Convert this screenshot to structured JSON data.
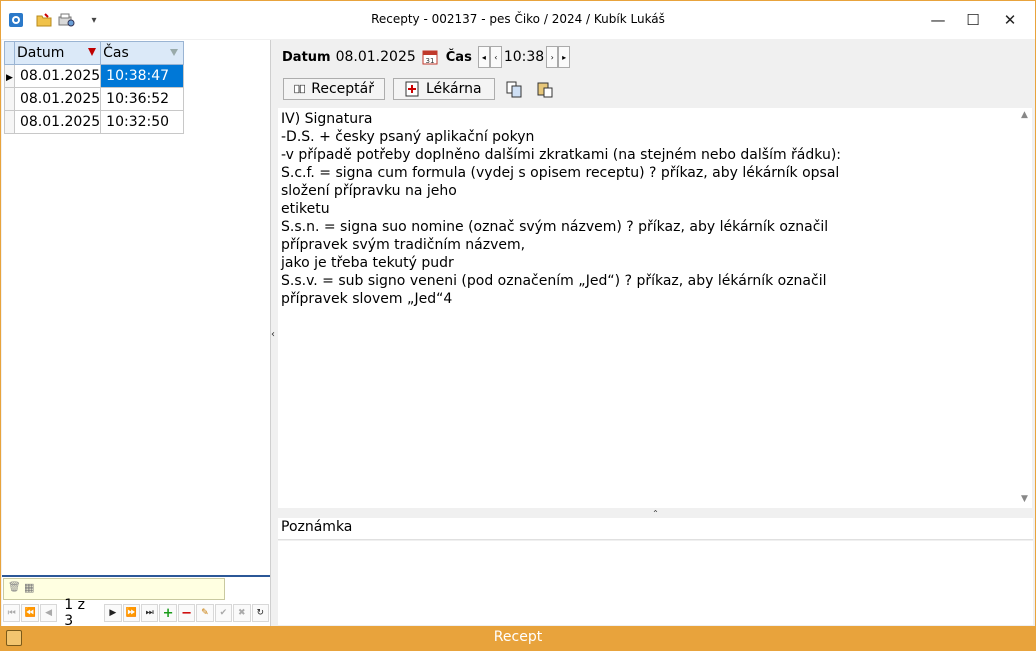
{
  "window": {
    "title": "Recepty - 002137 - pes Čiko / 2024 / Kubík Lukáš",
    "minimize_glyph": "—",
    "maximize_glyph": "☐",
    "close_glyph": "✕",
    "quick_access_more": "▾"
  },
  "grid": {
    "columns": [
      "Datum",
      "Čas"
    ],
    "rows": [
      {
        "datum": "08.01.2025",
        "cas": "10:38:47"
      },
      {
        "datum": "08.01.2025",
        "cas": "10:36:52"
      },
      {
        "datum": "08.01.2025",
        "cas": "10:32:50"
      }
    ],
    "selected_row": 0
  },
  "navigator": {
    "page_text": "1 z 3"
  },
  "header": {
    "datum_label": "Datum",
    "datum_value": "08.01.2025",
    "cas_label": "Čas",
    "cas_value": "10:38"
  },
  "buttons": {
    "receptar": "Receptář",
    "lekarna": "Lékárna"
  },
  "body_text": "IV) Signatura\n-D.S. + česky psaný aplikační pokyn\n-v případě potřeby doplněno dalšími zkratkami (na stejném nebo dalším řádku):\nS.c.f. = signa cum formula (vydej s opisem receptu) ? příkaz, aby lékárník opsal\nsložení přípravku na jeho\netiketu\nS.s.n. = signa suo nomine (označ svým názvem) ? příkaz, aby lékárník označil\npřípravek svým tradičním názvem,\njako je třeba tekutý pudr\nS.s.v. = sub signo veneni (pod označením „Jed“) ? příkaz, aby lékárník označil\npřípravek slovem „Jed“4",
  "note": {
    "label": "Poznámka",
    "value": ""
  },
  "status": {
    "text": "Recept"
  },
  "colors": {
    "accent": "#e8a33c",
    "selection": "#0078d7",
    "header_bg": "#dbe9f8"
  }
}
